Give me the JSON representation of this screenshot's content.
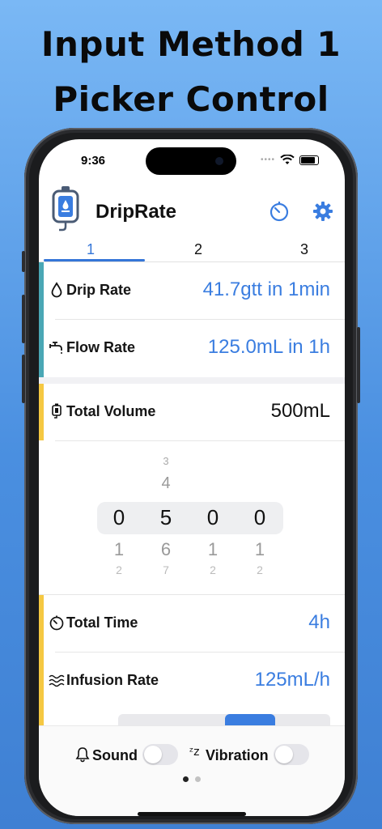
{
  "headline": {
    "line1": "Input Method 1",
    "line2": "Picker Control"
  },
  "status_bar": {
    "time": "9:36",
    "icons": [
      "wifi-icon",
      "battery-icon"
    ]
  },
  "app": {
    "title": "DripRate",
    "icons": [
      "iv-bag-icon",
      "timer-icon",
      "gear-icon"
    ]
  },
  "tabs": [
    {
      "label": "1",
      "active": true
    },
    {
      "label": "2",
      "active": false
    },
    {
      "label": "3",
      "active": false
    }
  ],
  "rate_section": {
    "accent_color": "#4aa7b5",
    "rows": [
      {
        "label": "Drip Rate",
        "value": "41.7gtt in 1min",
        "icon": "drop-icon"
      },
      {
        "label": "Flow Rate",
        "value": "125.0mL in 1h",
        "icon": "faucet-icon"
      }
    ]
  },
  "volume_section": {
    "accent_color": "#f5c842",
    "label": "Total Volume",
    "value": "500mL",
    "icon": "iv-bag-icon"
  },
  "picker": {
    "columns": [
      {
        "above2": "",
        "above1": "",
        "selected": "0",
        "below1": "1",
        "below2": "2"
      },
      {
        "above2": "3",
        "above1": "4",
        "selected": "5",
        "below1": "6",
        "below2": "7"
      },
      {
        "above2": "",
        "above1": "",
        "selected": "0",
        "below1": "1",
        "below2": "2"
      },
      {
        "above2": "",
        "above1": "",
        "selected": "0",
        "below1": "1",
        "below2": "2"
      }
    ]
  },
  "time_section": {
    "accent_color": "#f5c842",
    "rows": [
      {
        "label": "Total Time",
        "value": "4h",
        "icon": "timer-icon"
      },
      {
        "label": "Infusion Rate",
        "value": "125mL/h",
        "icon": "waves-icon"
      }
    ]
  },
  "bottom_bar": {
    "sound_label": "Sound",
    "sound_on": false,
    "vibration_label": "Vibration",
    "vibration_on": false,
    "page_dots": 2,
    "active_page": 1
  },
  "colors": {
    "accent": "#3a7de0",
    "background": "#5aa0ea"
  }
}
